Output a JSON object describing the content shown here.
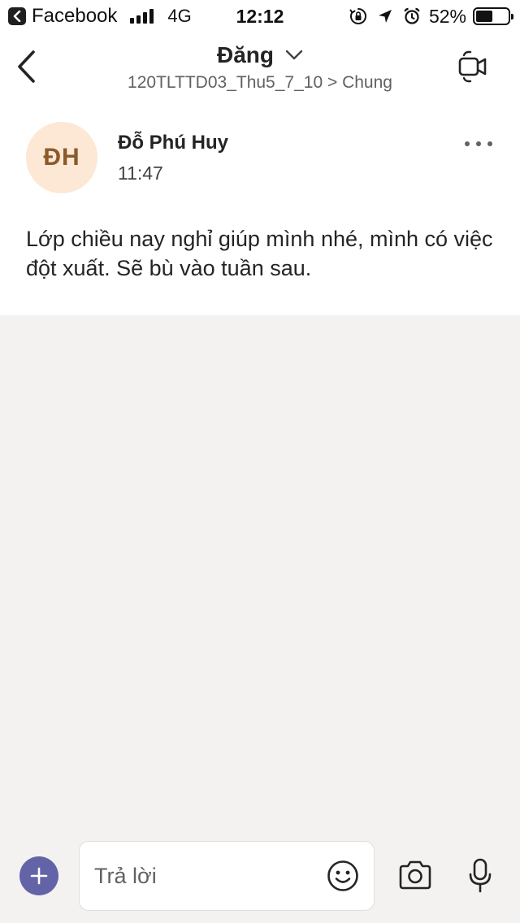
{
  "status_bar": {
    "app_name": "Facebook",
    "network": "4G",
    "time": "12:12",
    "battery_percent": "52%",
    "battery_level": 0.52,
    "icons": [
      "back-to-app-icon",
      "signal-bars-icon",
      "orientation-lock-icon",
      "location-arrow-icon",
      "alarm-icon",
      "battery-icon"
    ]
  },
  "header": {
    "title": "Đăng",
    "subtitle": "120TLTTD03_Thu5_7_10 > Chung",
    "icons": [
      "back-chevron-icon",
      "chevron-down-icon",
      "video-call-icon"
    ]
  },
  "message": {
    "avatar_initials": "ĐH",
    "avatar_color": "#fde7d5",
    "avatar_text_color": "#8a5a2b",
    "author": "Đỗ Phú Huy",
    "time": "11:47",
    "body": "Lớp chiều nay nghỉ giúp mình nhé, mình có việc đột xuất. Sẽ bù vào tuần sau.",
    "more_icon": "more-horizontal-icon"
  },
  "composer": {
    "placeholder": "Trả lời",
    "accent_color": "#6264a7",
    "icons": [
      "plus-icon",
      "emoji-icon",
      "camera-icon",
      "microphone-icon"
    ]
  }
}
